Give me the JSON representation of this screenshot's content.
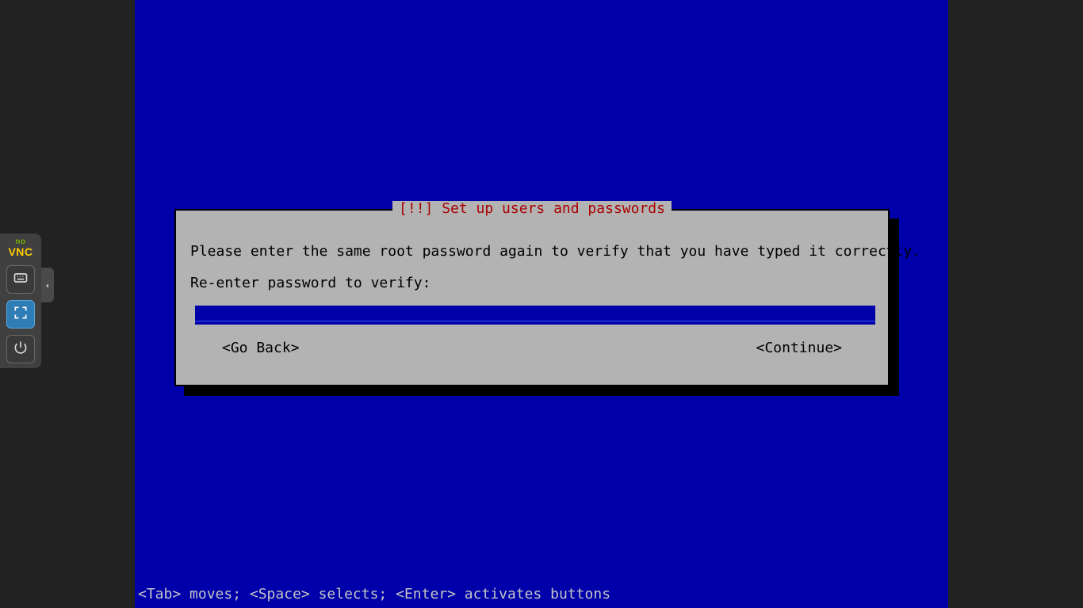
{
  "toolbar": {
    "logo_top": "no",
    "logo_bottom": "VNC"
  },
  "dialog": {
    "title": "[!!] Set up users and passwords",
    "instruction": "Please enter the same root password again to verify that you have typed it correctly.",
    "prompt": "Re-enter password to verify:",
    "input_fill": "_______________________________________________________________________________________________",
    "go_back": "<Go Back>",
    "continue": "<Continue>"
  },
  "help_line": "<Tab> moves; <Space> selects; <Enter> activates buttons"
}
